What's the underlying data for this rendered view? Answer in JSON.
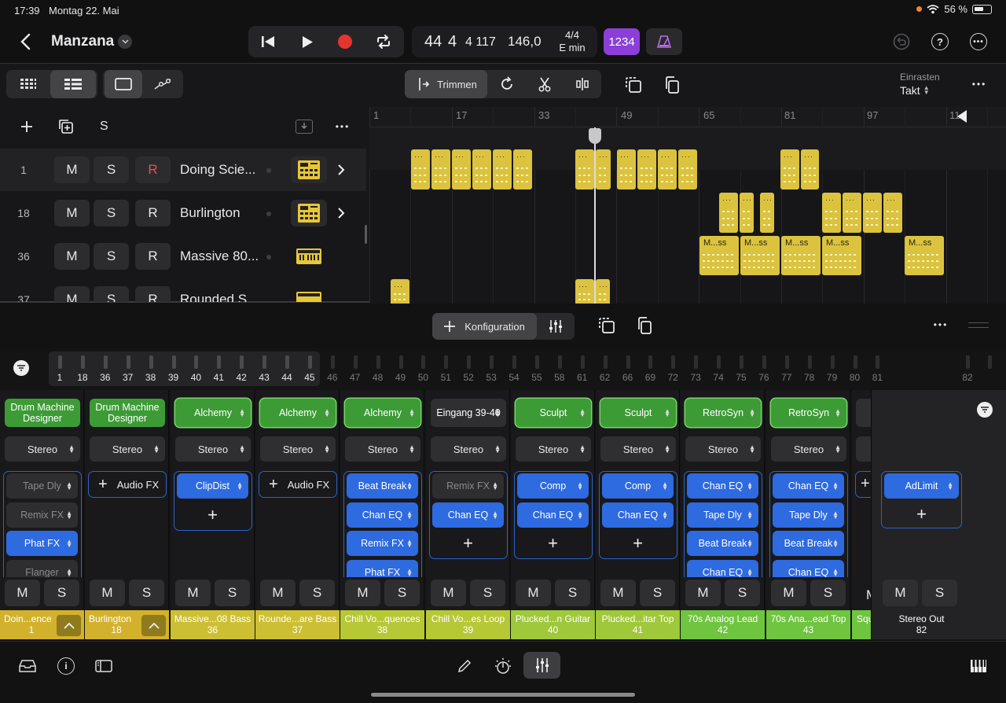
{
  "status": {
    "time": "17:39",
    "date": "Montag 22. Mai",
    "battery": "56 %"
  },
  "header": {
    "project": "Manzana"
  },
  "lcd": {
    "bar": "44",
    "beat": "4",
    "div_tick": "4 117",
    "tempo": "146,0",
    "signature": "4/4",
    "key": "E min"
  },
  "count_in": "1234",
  "toolbar": {
    "trim_label": "Trimmen",
    "snap_label": "Einrasten",
    "snap_value": "Takt"
  },
  "ruler": [
    "1",
    "17",
    "33",
    "49",
    "65",
    "81",
    "97",
    "11"
  ],
  "track_header": {
    "solo": "S"
  },
  "tracks": [
    {
      "num": "1",
      "m": "M",
      "s": "S",
      "r": "R",
      "name": "Doing Scie..."
    },
    {
      "num": "18",
      "m": "M",
      "s": "S",
      "r": "R",
      "name": "Burlington"
    },
    {
      "num": "36",
      "m": "M",
      "s": "S",
      "r": "R",
      "name": "Massive 80..."
    },
    {
      "num": "37",
      "m": "M",
      "s": "S",
      "r": "R",
      "name": "Rounded S..."
    }
  ],
  "regions_labels": [
    "M...ss"
  ],
  "config": {
    "label": "Konfiguration"
  },
  "channel_numbers": [
    "1",
    "18",
    "36",
    "37",
    "38",
    "39",
    "40",
    "41",
    "42",
    "43",
    "44",
    "45",
    "46",
    "47",
    "48",
    "49",
    "50",
    "51",
    "52",
    "53",
    "54",
    "55",
    "58",
    "61",
    "62",
    "66",
    "69",
    "72",
    "73",
    "74",
    "75",
    "76",
    "77",
    "78",
    "79",
    "80",
    "81",
    "82"
  ],
  "strips": [
    {
      "instrument": "Drum Machine Designer",
      "output": "Stereo",
      "fx": [
        "Tape Dly",
        "Remix FX",
        "Phat FX",
        "Flanger"
      ],
      "fx_on": [
        false,
        false,
        true,
        false
      ],
      "m": "M",
      "s": "S",
      "label": "Doin...ence",
      "num": "1",
      "color": "#d2b22d"
    },
    {
      "instrument": "Drum Machine Designer",
      "output": "Stereo",
      "audio_fx": "Audio FX",
      "m": "M",
      "s": "S",
      "label": "Burlington",
      "num": "18",
      "color": "#d2b22d"
    },
    {
      "instrument": "Alchemy",
      "output": "Stereo",
      "fx": [
        "ClipDist"
      ],
      "fx_on": [
        true
      ],
      "m": "M",
      "s": "S",
      "label": "Massive...08 Bass",
      "num": "36",
      "color": "#cdbf34"
    },
    {
      "instrument": "Alchemy",
      "output": "Stereo",
      "audio_fx": "Audio FX",
      "m": "M",
      "s": "S",
      "label": "Rounde...are Bass",
      "num": "37",
      "color": "#cdbf34"
    },
    {
      "instrument": "Alchemy",
      "output": "Stereo",
      "fx": [
        "Beat Break",
        "Chan EQ",
        "Remix FX",
        "Phat FX"
      ],
      "fx_on": [
        true,
        true,
        true,
        true
      ],
      "m": "M",
      "s": "S",
      "label": "Chill Vo...quences",
      "num": "38",
      "color": "#b7c836"
    },
    {
      "instrument": "Eingang 39-40",
      "output": "Stereo",
      "fx": [
        "Remix FX",
        "Chan EQ"
      ],
      "fx_on": [
        false,
        true
      ],
      "m": "M",
      "s": "S",
      "label": "Chill Vo...es Loop",
      "num": "39",
      "color": "#b7c836"
    },
    {
      "instrument": "Sculpt",
      "output": "Stereo",
      "fx": [
        "Comp",
        "Chan EQ"
      ],
      "fx_on": [
        true,
        true
      ],
      "m": "M",
      "s": "S",
      "label": "Plucked...n Guitar",
      "num": "40",
      "color": "#9fc83a"
    },
    {
      "instrument": "Sculpt",
      "output": "Stereo",
      "fx": [
        "Comp",
        "Chan EQ"
      ],
      "fx_on": [
        true,
        true
      ],
      "m": "M",
      "s": "S",
      "label": "Plucked...itar Top",
      "num": "41",
      "color": "#9fc83a"
    },
    {
      "instrument": "RetroSyn",
      "output": "Stereo",
      "fx": [
        "Chan EQ",
        "Tape Dly",
        "Beat Break",
        "Chan EQ"
      ],
      "fx_on": [
        true,
        true,
        true,
        true
      ],
      "m": "M",
      "s": "S",
      "label": "70s Analog Lead",
      "num": "42",
      "color": "#6fc440"
    },
    {
      "instrument": "RetroSyn",
      "output": "Stereo",
      "fx": [
        "Chan EQ",
        "Tape Dly",
        "Beat Break",
        "Chan EQ"
      ],
      "fx_on": [
        true,
        true,
        true,
        true
      ],
      "m": "M",
      "s": "S",
      "label": "70s Ana...ead Top",
      "num": "43",
      "color": "#6fc440"
    }
  ],
  "partial_strip": {
    "m": "M",
    "label": "Squ"
  },
  "stereo_out": {
    "fx": "AdLimit",
    "m": "M",
    "s": "S",
    "label": "Stereo Out",
    "num": "82"
  },
  "colors": {
    "accent": "#2e6ae0",
    "instrument": "#3d9b36",
    "region": "#dcc33f",
    "count_in": "#8b3fd8",
    "record": "#e5342f"
  }
}
